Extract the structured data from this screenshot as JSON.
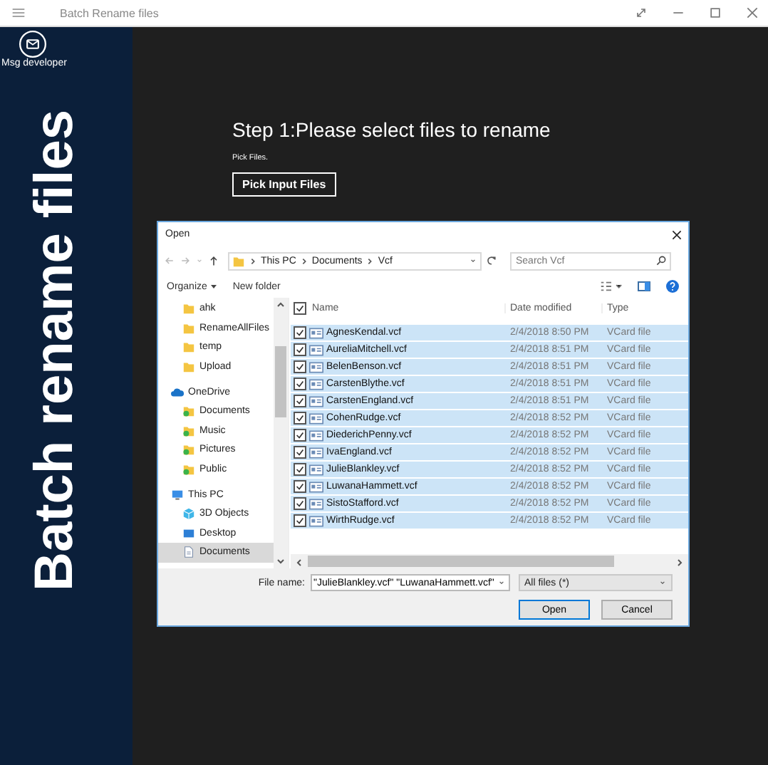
{
  "window": {
    "title": "Batch Rename files"
  },
  "sidebar": {
    "contact_label": "Msg developer",
    "banner": "Batch rename files"
  },
  "main": {
    "heading": "Step 1:Please select files to rename",
    "hint": "Pick Files.",
    "button": "Pick Input Files"
  },
  "dialog": {
    "title": "Open",
    "breadcrumb": [
      "This PC",
      "Documents",
      "Vcf"
    ],
    "search": {
      "placeholder": "Search Vcf"
    },
    "toolbar": {
      "organize": "Organize",
      "new_folder": "New folder"
    },
    "nav": {
      "scrolled_items": [
        {
          "label": "ahk",
          "kind": "folder",
          "selected": false
        },
        {
          "label": "RenameAllFiles",
          "kind": "folder",
          "selected": false
        },
        {
          "label": "temp",
          "kind": "folder",
          "selected": false
        },
        {
          "label": "Upload",
          "kind": "folder",
          "selected": false
        }
      ],
      "items": [
        {
          "label": "OneDrive",
          "kind": "cloud",
          "selected": false,
          "children": [
            {
              "label": "Documents",
              "kind": "synced",
              "selected": false
            },
            {
              "label": "Music",
              "kind": "synced",
              "selected": false
            },
            {
              "label": "Pictures",
              "kind": "synced",
              "selected": false
            },
            {
              "label": "Public",
              "kind": "synced",
              "selected": false
            }
          ]
        },
        {
          "label": "This PC",
          "kind": "pc",
          "selected": false,
          "children": [
            {
              "label": "3D Objects",
              "kind": "cube",
              "selected": false
            },
            {
              "label": "Desktop",
              "kind": "desktop",
              "selected": false
            },
            {
              "label": "Documents",
              "kind": "document",
              "selected": true
            }
          ]
        }
      ]
    },
    "table": {
      "header_checked": true,
      "columns": [
        "Name",
        "Date modified",
        "Type"
      ],
      "rows": [
        {
          "name": "AgnesKendal.vcf",
          "date": "2/4/2018 8:50 PM",
          "type": "VCard file",
          "checked": true,
          "selected": true
        },
        {
          "name": "AureliaMitchell.vcf",
          "date": "2/4/2018 8:51 PM",
          "type": "VCard file",
          "checked": true,
          "selected": true
        },
        {
          "name": "BelenBenson.vcf",
          "date": "2/4/2018 8:51 PM",
          "type": "VCard file",
          "checked": true,
          "selected": true
        },
        {
          "name": "CarstenBlythe.vcf",
          "date": "2/4/2018 8:51 PM",
          "type": "VCard file",
          "checked": true,
          "selected": true
        },
        {
          "name": "CarstenEngland.vcf",
          "date": "2/4/2018 8:51 PM",
          "type": "VCard file",
          "checked": true,
          "selected": true
        },
        {
          "name": "CohenRudge.vcf",
          "date": "2/4/2018 8:52 PM",
          "type": "VCard file",
          "checked": true,
          "selected": true
        },
        {
          "name": "DiederichPenny.vcf",
          "date": "2/4/2018 8:52 PM",
          "type": "VCard file",
          "checked": true,
          "selected": true
        },
        {
          "name": "IvaEngland.vcf",
          "date": "2/4/2018 8:52 PM",
          "type": "VCard file",
          "checked": true,
          "selected": true
        },
        {
          "name": "JulieBlankley.vcf",
          "date": "2/4/2018 8:52 PM",
          "type": "VCard file",
          "checked": true,
          "selected": true
        },
        {
          "name": "LuwanaHammett.vcf",
          "date": "2/4/2018 8:52 PM",
          "type": "VCard file",
          "checked": true,
          "selected": true
        },
        {
          "name": "SistoStafford.vcf",
          "date": "2/4/2018 8:52 PM",
          "type": "VCard file",
          "checked": true,
          "selected": true
        },
        {
          "name": "WirthRudge.vcf",
          "date": "2/4/2018 8:52 PM",
          "type": "VCard file",
          "checked": true,
          "selected": true
        }
      ]
    },
    "file_name_label": "File name:",
    "file_name": "\"JulieBlankley.vcf\" \"LuwanaHammett.vcf\"",
    "file_type": "All files (*)",
    "buttons": [
      "Open",
      "Cancel"
    ]
  }
}
